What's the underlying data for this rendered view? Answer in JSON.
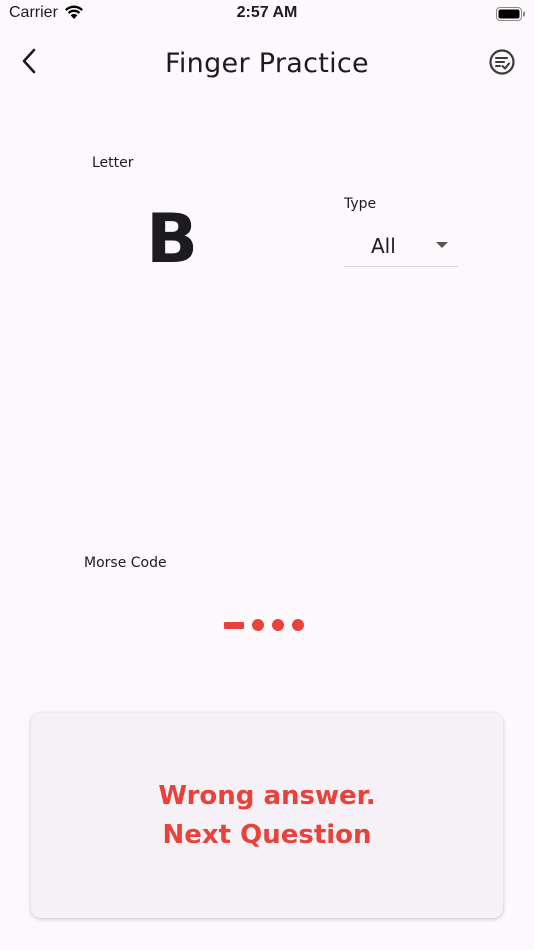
{
  "status_bar": {
    "carrier": "Carrier",
    "time": "2:57 AM",
    "wifi_icon": "wifi-icon",
    "battery_icon": "battery-icon"
  },
  "app_bar": {
    "title": "Finger Practice",
    "back_icon": "chevron-left-icon",
    "action_icon": "checklist-icon"
  },
  "letter": {
    "label": "Letter",
    "value": "B"
  },
  "type": {
    "label": "Type",
    "value": "All"
  },
  "morse": {
    "label": "Morse Code",
    "symbols": [
      "dash",
      "dot",
      "dot",
      "dot"
    ],
    "color": "#e8423b"
  },
  "result": {
    "line1": "Wrong answer.",
    "line2": "Next Question",
    "color": "#e8423b"
  }
}
